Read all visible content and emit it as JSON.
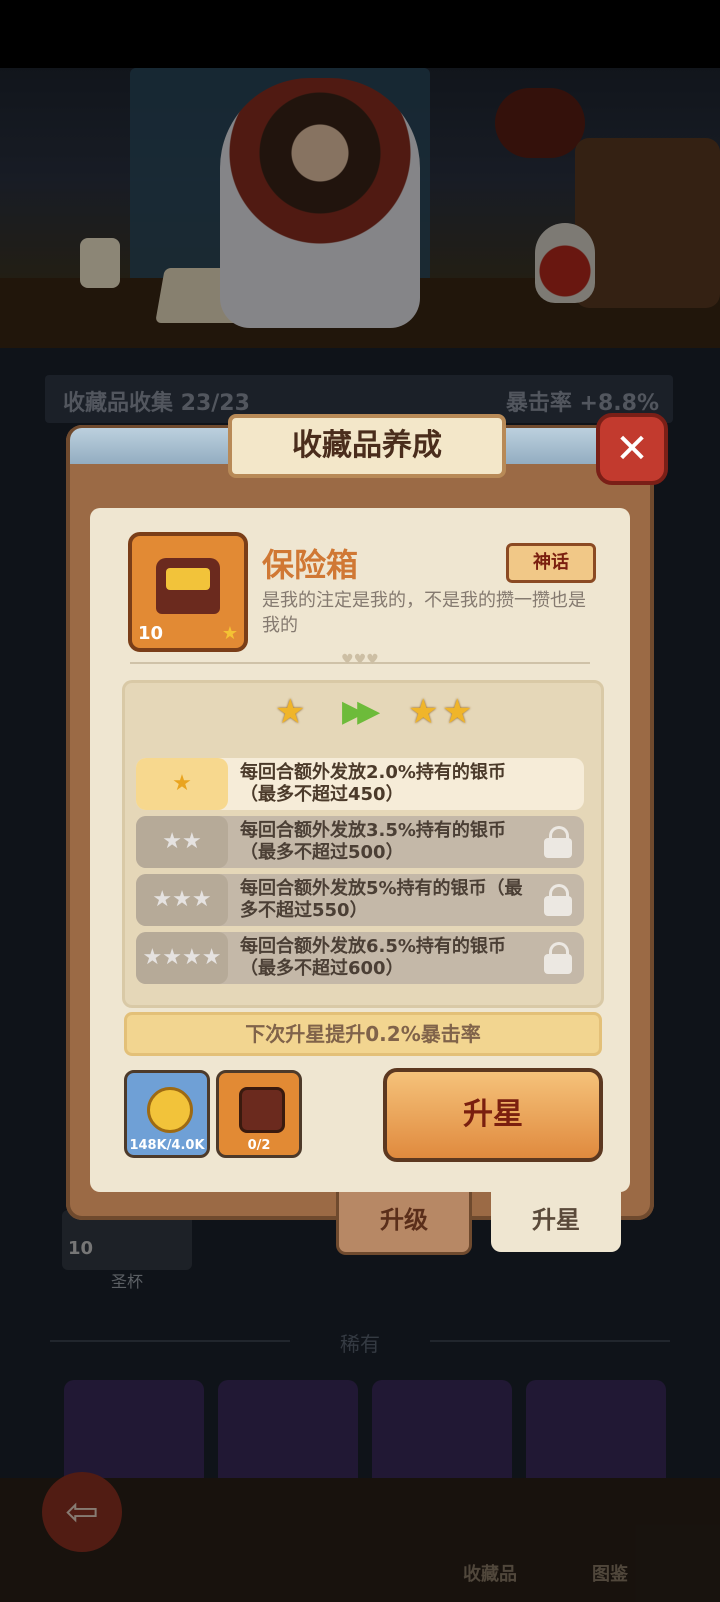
{
  "background": {
    "collection_label": "收藏品收集 23/23",
    "crit_label": "暴击率 +8.8%",
    "item_level": "10",
    "item_name": "圣杯",
    "rare_section": "稀有",
    "nav_collection": "收藏品",
    "nav_codex": "图鉴"
  },
  "modal": {
    "title": "收藏品养成",
    "close": "✕",
    "item": {
      "name": "保险箱",
      "rarity": "神话",
      "description": "是我的注定是我的，不是我的攒一攒也是我的",
      "level": "10"
    },
    "star_upgrade": {
      "from_stars": 1,
      "to_stars": 2,
      "rows": [
        {
          "stars": "★",
          "text": "每回合额外发放2.0%持有的银币（最多不超过450）",
          "locked": false
        },
        {
          "stars": "★★",
          "text": "每回合额外发放3.5%持有的银币（最多不超过500）",
          "locked": true
        },
        {
          "stars": "★★★",
          "text": "每回合额外发放5%持有的银币（最多不超过550）",
          "locked": true
        },
        {
          "stars": "★★★★",
          "text": "每回合额外发放6.5%持有的银币（最多不超过600）",
          "locked": true
        }
      ]
    },
    "next_bonus": "下次升星提升0.2%暴击率",
    "costs": [
      {
        "name": "silver-coin",
        "amount": "148K/4.0K",
        "color": "#6fa0d6"
      },
      {
        "name": "safe-box",
        "amount": "0/2",
        "color": "#e28a34"
      }
    ],
    "upstar_button": "升星",
    "tabs": {
      "upgrade": "升级",
      "upstar": "升星"
    }
  }
}
